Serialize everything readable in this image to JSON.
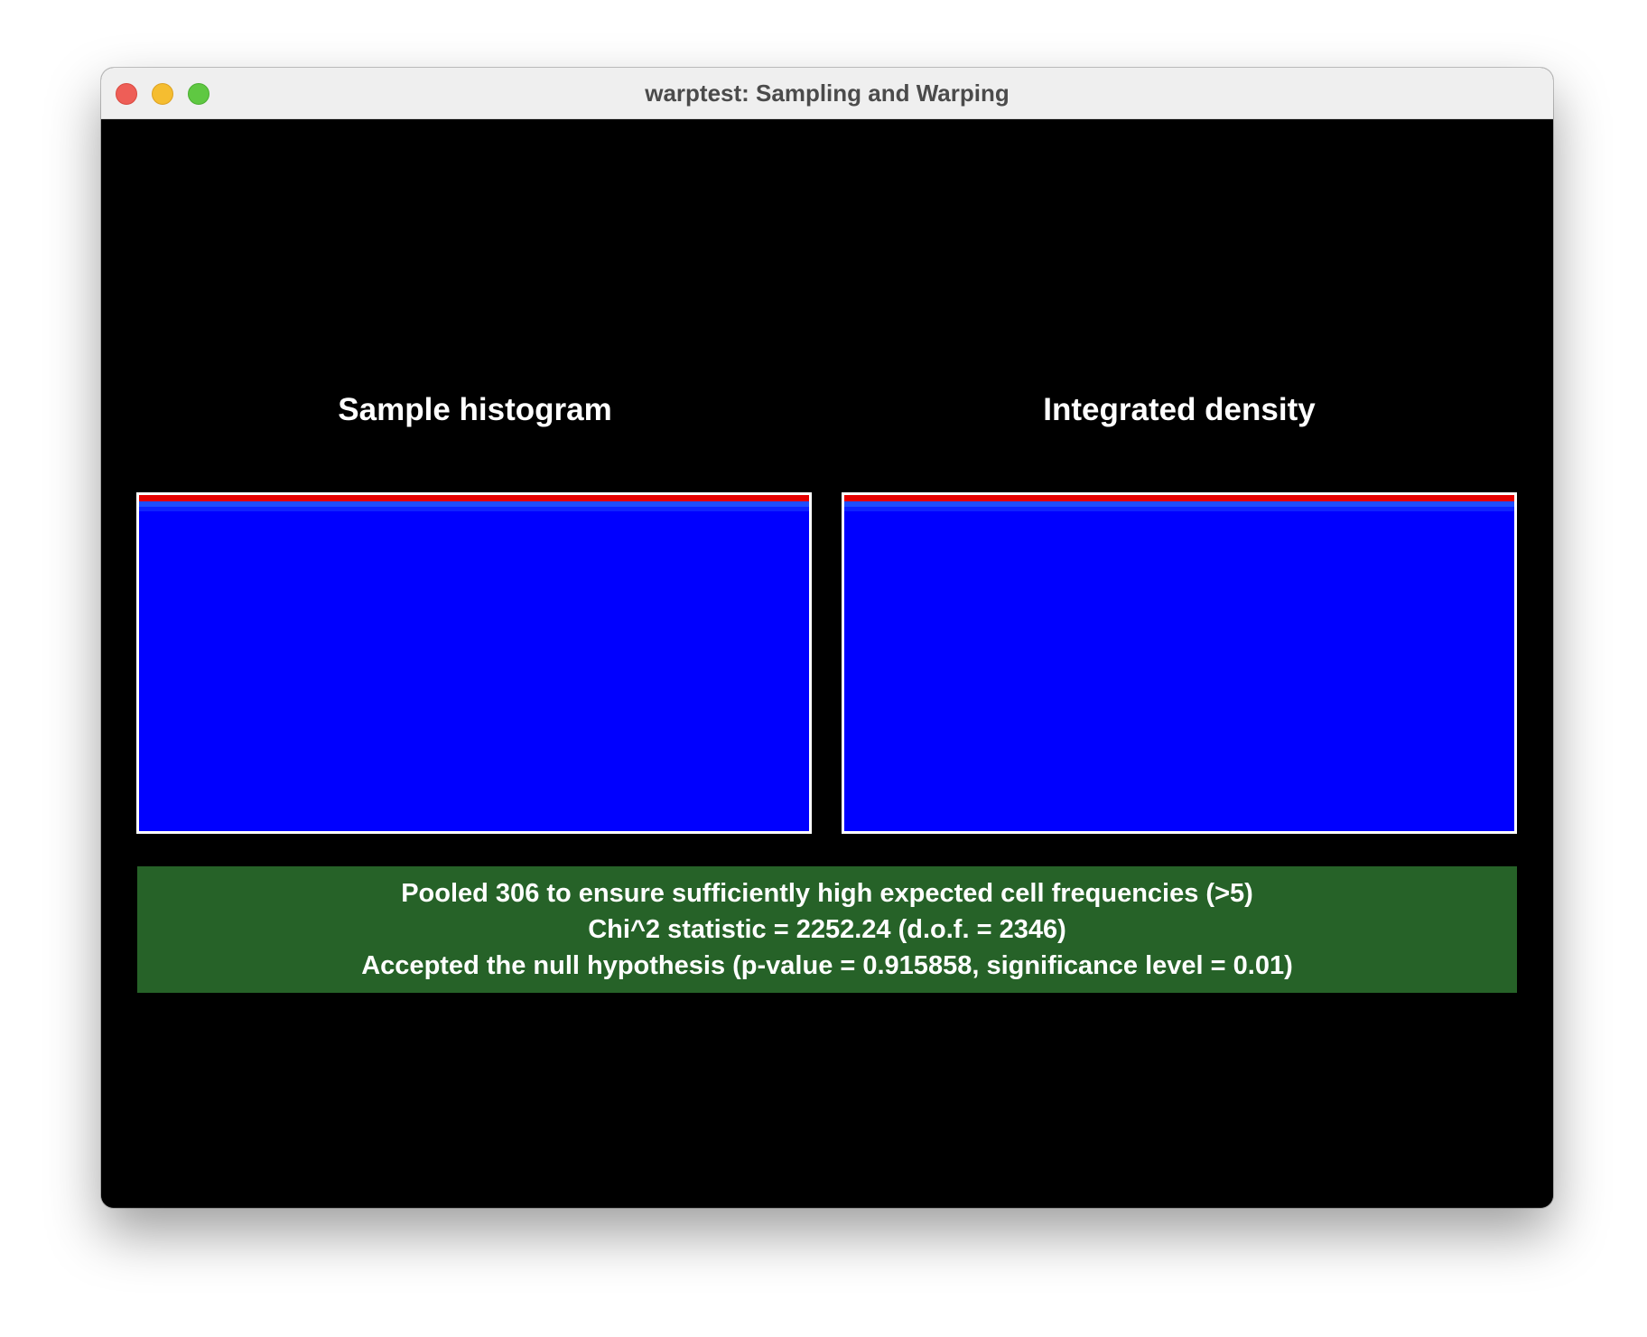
{
  "window": {
    "title": "warptest: Sampling and Warping"
  },
  "panels": {
    "left_title": "Sample histogram",
    "right_title": "Integrated density"
  },
  "status": {
    "line1": "Pooled 306 to ensure sufficiently high expected cell frequencies (>5)",
    "line2": "Chi^2 statistic = 2252.24 (d.o.f. = 2346)",
    "line3": "Accepted the null hypothesis (p-value = 0.915858, significance level = 0.01)"
  },
  "colors": {
    "plot_fill": "#0000ff",
    "plot_top_band": "#e50000",
    "status_background": "#266228",
    "content_background": "#000000"
  },
  "icons": {
    "close": "close-icon",
    "minimize": "minimize-icon",
    "maximize": "maximize-icon"
  }
}
